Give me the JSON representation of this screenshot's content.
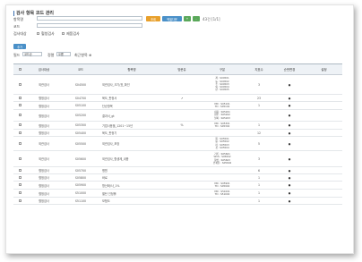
{
  "page": {
    "title": "검사 항목 코드 관리"
  },
  "search": {
    "item_label": "항목명",
    "code_label": "코드",
    "type_label": "검사대상",
    "option1": "혈청검사",
    "option2": "제품검사",
    "search_btn": "조회",
    "excel_btn": "엑셀다운",
    "add_btn": "+",
    "del_btn": "-",
    "page_info": "43건 [1/1]"
  },
  "toolbar": {
    "new_btn": "추가",
    "sort1_label": "필드",
    "sort1_value": "코드순",
    "sort2_label": "정렬",
    "sort2_value": "오름",
    "extra_label": "최근항목 ⊕"
  },
  "table": {
    "headers": [
      "",
      "검사대상",
      "코드",
      "항목명",
      "방문유",
      "구분",
      "지표수",
      "순번변경",
      "설정"
    ],
    "rows": [
      {
        "type": "외관검사",
        "code": "S04500",
        "name": "외관검사_크기/표_확인",
        "visit": "",
        "cat": "제 : S04501\n농 : S04502\n수 : S04503\n외 : S04504\n판 : S04505",
        "count": "3",
        "order": "●"
      },
      {
        "type": "혈청검사",
        "code": "S04700",
        "name": "육도_판정서",
        "visit": "↗",
        "cat": "",
        "count": "23",
        "order": "●"
      },
      {
        "type": "혈청검사",
        "code": "S05100",
        "name": "단순항목",
        "visit": "",
        "cat": "MD : S05101\nTD : S05102",
        "count": "1",
        "order": "●"
      },
      {
        "type": "혈청검사",
        "code": "S05200",
        "name": "결과서_gt",
        "visit": "",
        "cat": "내용 : S05201\n원본 : S05202\n날짜 : S05203",
        "count": "",
        "order": "●"
      },
      {
        "type": "혈청검사",
        "code": "S05300",
        "name": "기업사용율_1201~15년",
        "visit": "%",
        "cat": "MD : S05301\nTD : S05302",
        "count": "1",
        "order": "●"
      },
      {
        "type": "혈청검사",
        "code": "S05400",
        "name": "육도_판정기",
        "visit": "",
        "cat": "",
        "count": "12",
        "order": "●"
      },
      {
        "type": "외관검사",
        "code": "S05500",
        "name": "외관검사_포장",
        "visit": "",
        "cat": "원 : S05501\n봉 : S05502\n라 : S05503\n갯 : S05504",
        "count": "5",
        "order": "●"
      },
      {
        "type": "외관검사",
        "code": "S05600",
        "name": "외관검사_항생제_내용",
        "visit": "",
        "cat": "기록 : S05601\nWVS : S05602\n양성 : S05603\n인쇄물 : S05604",
        "count": "3",
        "order": "●"
      },
      {
        "type": "혈청검사",
        "code": "S05700",
        "name": "병원",
        "visit": "",
        "cat": "",
        "count": "6",
        "order": "●"
      },
      {
        "type": "혈청검사",
        "code": "S05800",
        "name": "바로",
        "visit": "",
        "cat": "",
        "count": "1",
        "order": "●"
      },
      {
        "type": "혈청검사",
        "code": "S05900",
        "name": "항산화/사_1%",
        "visit": "",
        "cat": "MD : S05901\nTD : S05902",
        "count": "1",
        "order": "●"
      },
      {
        "type": "혈청검사",
        "code": "S51000",
        "name": "멸탄 인정률",
        "visit": "",
        "cat": "MD : S51001\nTD : S51002",
        "count": "1",
        "order": "●"
      },
      {
        "type": "혈청검사",
        "code": "S51100",
        "name": "보험도",
        "visit": "",
        "cat": "",
        "count": "1",
        "order": "●"
      }
    ]
  },
  "colors": {
    "search": "#e8a02c",
    "excel": "#4a90c8",
    "plus": "#5aa85a",
    "minus": "#5aa85a",
    "new": "#4a90c8"
  }
}
